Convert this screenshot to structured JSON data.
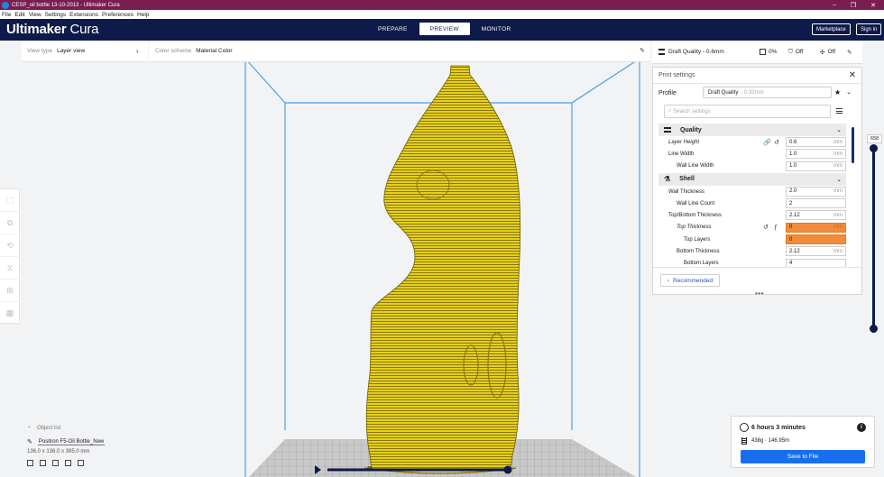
{
  "window": {
    "title": "CESP_oil bottle 13-10-2013 - Ultimaker Cura",
    "controls": [
      "minimize-icon",
      "maximize-icon",
      "close-icon"
    ]
  },
  "menu": [
    "File",
    "Edit",
    "View",
    "Settings",
    "Extensions",
    "Preferences",
    "Help"
  ],
  "header": {
    "brand_bold": "Ultimaker",
    "brand_light": "Cura",
    "stages": [
      {
        "label": "PREPARE",
        "active": false
      },
      {
        "label": "PREVIEW",
        "active": true
      },
      {
        "label": "MONITOR",
        "active": false
      }
    ],
    "marketplace": "Marketplace",
    "signin": "Sign in"
  },
  "viewbar": {
    "view_type_label": "View type",
    "view_type_value": "Layer view",
    "color_scheme_label": "Color scheme",
    "color_scheme_value": "Material Color"
  },
  "setup": {
    "profile": "Draft Quality - 0.6mm",
    "infill": "0%",
    "support": "Off",
    "adhesion": "Off"
  },
  "panel": {
    "title": "Print settings",
    "profile_label": "Profile",
    "profile_value": "Draft Quality",
    "profile_sub": "- 0.32mm",
    "search_placeholder": "Search settings",
    "categories": [
      {
        "name": "Quality",
        "settings": [
          {
            "name": "Layer Height",
            "value": "0.6",
            "unit": "mm",
            "indent": 0,
            "italic": true,
            "warn": false,
            "icons": [
              "link-icon",
              "reset-icon"
            ]
          },
          {
            "name": "Line Width",
            "value": "1.0",
            "unit": "mm",
            "indent": 0,
            "italic": false,
            "warn": false,
            "icons": []
          },
          {
            "name": "Wall Line Width",
            "value": "1.0",
            "unit": "mm",
            "indent": 1,
            "italic": false,
            "warn": false,
            "icons": []
          }
        ]
      },
      {
        "name": "Shell",
        "settings": [
          {
            "name": "Wall Thickness",
            "value": "2.0",
            "unit": "mm",
            "indent": 0,
            "italic": false,
            "warn": false,
            "icons": []
          },
          {
            "name": "Wall Line Count",
            "value": "2",
            "unit": "",
            "indent": 1,
            "italic": false,
            "warn": false,
            "icons": []
          },
          {
            "name": "Top/Bottom Thickness",
            "value": "2.12",
            "unit": "mm",
            "indent": 0,
            "italic": false,
            "warn": false,
            "icons": []
          },
          {
            "name": "Top Thickness",
            "value": "0",
            "unit": "mm",
            "indent": 1,
            "italic": true,
            "warn": true,
            "icons": [
              "reset-icon",
              "function-icon"
            ]
          },
          {
            "name": "Top Layers",
            "value": "0",
            "unit": "",
            "indent": 2,
            "italic": false,
            "warn": true,
            "icons": []
          },
          {
            "name": "Bottom Thickness",
            "value": "2.12",
            "unit": "mm",
            "indent": 1,
            "italic": false,
            "warn": false,
            "icons": []
          },
          {
            "name": "Bottom Layers",
            "value": "4",
            "unit": "",
            "indent": 2,
            "italic": false,
            "warn": false,
            "icons": []
          }
        ]
      }
    ],
    "recommended": "Recommended"
  },
  "layer_slider": {
    "current": "658",
    "position": 1.0
  },
  "objects": {
    "header": "Object list",
    "name": "Positron F5-Oil Bottle_New",
    "dims": "136.0 x 136.0 x 395.0 mm"
  },
  "output": {
    "time": "6 hours 3 minutes",
    "material": "438g · 146.95m",
    "save": "Save to File"
  },
  "colors": {
    "header": "#0e1a49",
    "titlebar": "#7a1d4f",
    "model": "#e9d21b",
    "accent": "#196ef0",
    "warning": "#f28c3a"
  }
}
